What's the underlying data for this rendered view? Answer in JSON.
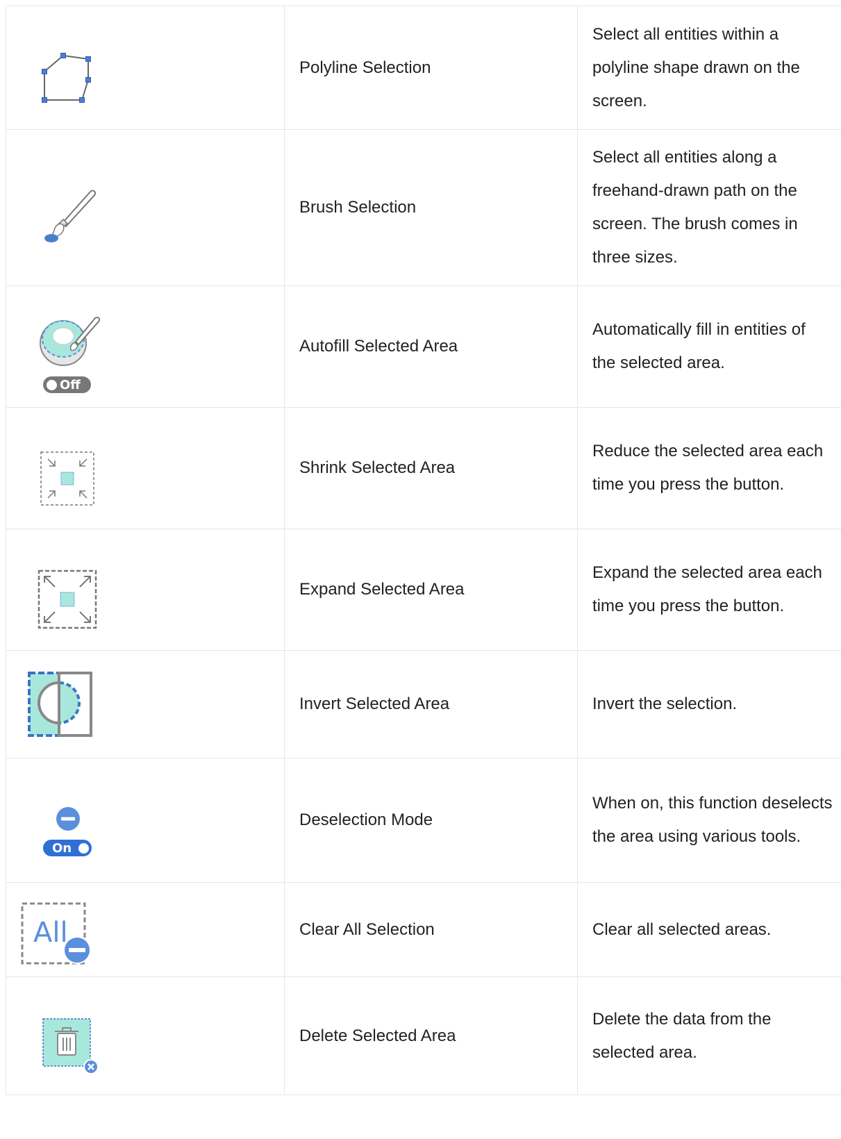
{
  "rows": [
    {
      "icon": "polyline-selection-icon",
      "name": "Polyline Selection",
      "description": "Select all entities within a polyline shape drawn on the screen."
    },
    {
      "icon": "brush-selection-icon",
      "name": "Brush Selection",
      "description": "Select all entities along a freehand-drawn path on the screen. The brush comes in three sizes."
    },
    {
      "icon": "autofill-icon",
      "name": "Autofill Selected Area",
      "description": "Automatically fill in entities of the selected area.",
      "toggle_label": "Off"
    },
    {
      "icon": "shrink-icon",
      "name": "Shrink Selected Area",
      "description": "Reduce the selected area each time you press the button."
    },
    {
      "icon": "expand-icon",
      "name": "Expand Selected Area",
      "description": "Expand the selected area each time you press the button."
    },
    {
      "icon": "invert-icon",
      "name": "Invert Selected Area",
      "description": "Invert the selection."
    },
    {
      "icon": "deselection-mode-icon",
      "name": "Deselection Mode",
      "description": "When on, this function deselects the area using various tools.",
      "toggle_label": "On"
    },
    {
      "icon": "clear-all-icon",
      "name": "Clear All Selection",
      "description": "Clear all selected areas.",
      "icon_text": "All"
    },
    {
      "icon": "delete-area-icon",
      "name": "Delete Selected Area",
      "description": "Delete the data from the selected area."
    }
  ],
  "colors": {
    "accent": "#5b8fdc",
    "fill": "#a8e8dc",
    "gray": "#888888",
    "border": "#e6e6e6",
    "toggle_on": "#2f6fd6"
  }
}
